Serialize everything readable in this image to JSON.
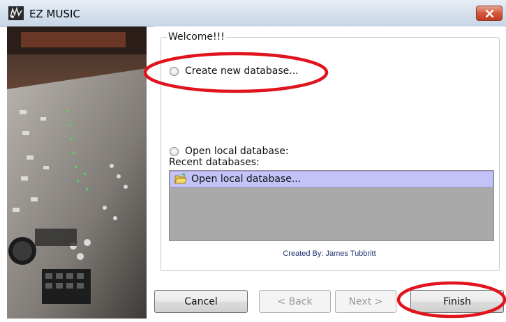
{
  "window": {
    "title": "EZ MUSIC"
  },
  "welcome": {
    "legend": "Welcome!!!",
    "create_new": "Create new database...",
    "open_local": "Open local database:",
    "recent_label": "Recent databases:",
    "recent_items": [
      {
        "label": "Open local database..."
      }
    ],
    "credit": "Created By: James Tubbritt"
  },
  "buttons": {
    "cancel": "Cancel",
    "back": "< Back",
    "next": "Next >",
    "finish": "Finish"
  },
  "colors": {
    "selection": "#c3c3f7",
    "list_background": "#a9a9a9",
    "annotation": "#e0141c",
    "credit_text": "#1c2f6e"
  }
}
